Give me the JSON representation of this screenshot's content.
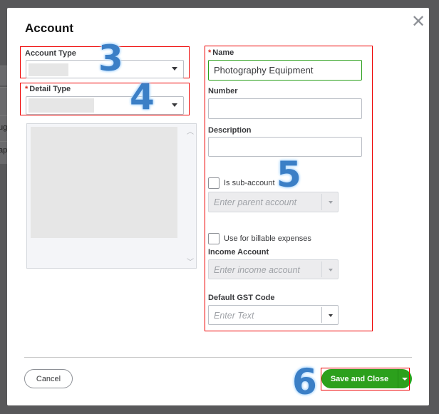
{
  "background": {
    "rows": [
      "ug",
      "ap"
    ]
  },
  "dialog": {
    "title": "Account",
    "close_icon": "close-icon",
    "account_type": {
      "label": "Account Type"
    },
    "detail_type": {
      "label": "Detail Type",
      "required_mark": "*"
    },
    "name": {
      "label": "Name",
      "required_mark": "*",
      "value": "Photography Equipment"
    },
    "number": {
      "label": "Number",
      "value": ""
    },
    "description": {
      "label": "Description",
      "value": ""
    },
    "sub_account": {
      "label": "Is sub-account",
      "checked": false,
      "placeholder": "Enter parent account"
    },
    "billable": {
      "label": "Use for billable expenses",
      "checked": false
    },
    "income_account": {
      "label": "Income Account",
      "placeholder": "Enter income account"
    },
    "gst_code": {
      "label": "Default GST Code",
      "placeholder": "Enter Text"
    },
    "cancel_label": "Cancel",
    "save_label": "Save and Close"
  },
  "annotations": [
    "3",
    "4",
    "5",
    "6"
  ],
  "colors": {
    "accent": "#2ca01c",
    "highlight": "#e00000",
    "annotation": "#3b7fc6"
  }
}
